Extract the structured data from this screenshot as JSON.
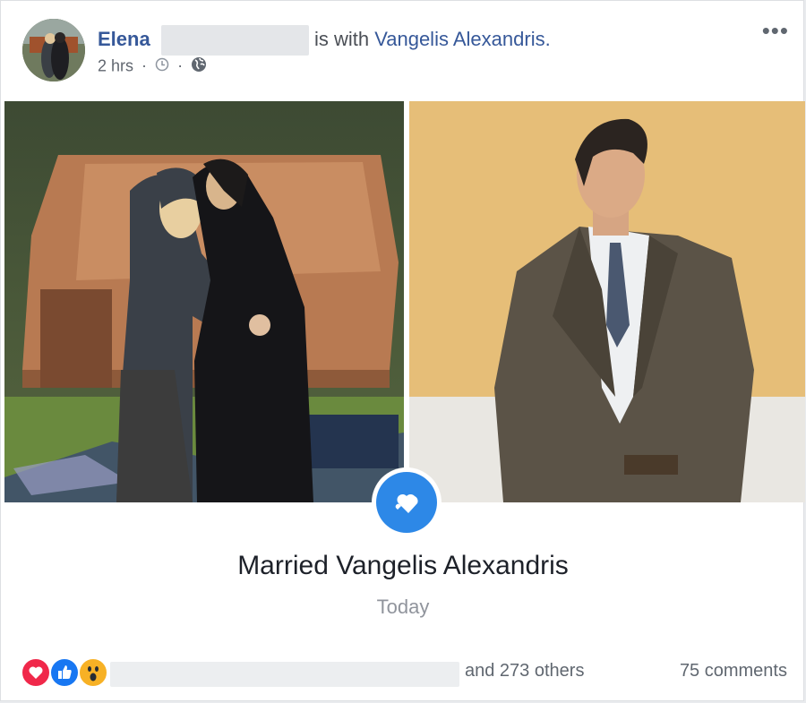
{
  "post": {
    "author": "Elena",
    "with_text": "is with",
    "with_name": "Vangelis Alexandris.",
    "time": "2 hrs",
    "separator": "·",
    "more_label": "•••"
  },
  "life_event": {
    "title": "Married Vangelis Alexandris",
    "date": "Today"
  },
  "footer": {
    "others": "and 273 others",
    "comments": "75 comments"
  },
  "icons": [
    "clock-icon",
    "globe-icon",
    "more-options-icon",
    "hearts-icon",
    "love-reaction-icon",
    "like-reaction-icon",
    "wow-reaction-icon"
  ],
  "colors": {
    "link": "#365899",
    "event_blue": "#2d88e7",
    "love": "#f0284a",
    "like": "#1877f2",
    "wow": "#f7b125"
  }
}
